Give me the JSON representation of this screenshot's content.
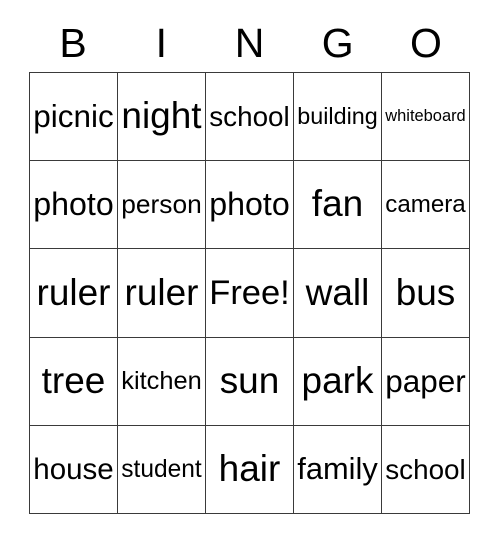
{
  "card": {
    "title": "BINGO",
    "header_letters": [
      "B",
      "I",
      "N",
      "G",
      "O"
    ],
    "free_space_label": "Free!",
    "grid_size": 5,
    "colors": {
      "background": "#ffffff",
      "border": "#3a3a3a",
      "text": "#000000"
    },
    "rows": [
      {
        "cells": [
          {
            "label": "picnic",
            "free": false
          },
          {
            "label": "night",
            "free": false
          },
          {
            "label": "school",
            "free": false
          },
          {
            "label": "building",
            "free": false
          },
          {
            "label": "whiteboard",
            "free": false
          }
        ]
      },
      {
        "cells": [
          {
            "label": "photo",
            "free": false
          },
          {
            "label": "person",
            "free": false
          },
          {
            "label": "photo",
            "free": false
          },
          {
            "label": "fan",
            "free": false
          },
          {
            "label": "camera",
            "free": false
          }
        ]
      },
      {
        "cells": [
          {
            "label": "ruler",
            "free": false
          },
          {
            "label": "ruler",
            "free": false
          },
          {
            "label": "Free!",
            "free": true
          },
          {
            "label": "wall",
            "free": false
          },
          {
            "label": "bus",
            "free": false
          }
        ]
      },
      {
        "cells": [
          {
            "label": "tree",
            "free": false
          },
          {
            "label": "kitchen",
            "free": false
          },
          {
            "label": "sun",
            "free": false
          },
          {
            "label": "park",
            "free": false
          },
          {
            "label": "paper",
            "free": false
          }
        ]
      },
      {
        "cells": [
          {
            "label": "house",
            "free": false
          },
          {
            "label": "student",
            "free": false
          },
          {
            "label": "hair",
            "free": false
          },
          {
            "label": "family",
            "free": false
          },
          {
            "label": "school",
            "free": false
          }
        ]
      }
    ]
  }
}
